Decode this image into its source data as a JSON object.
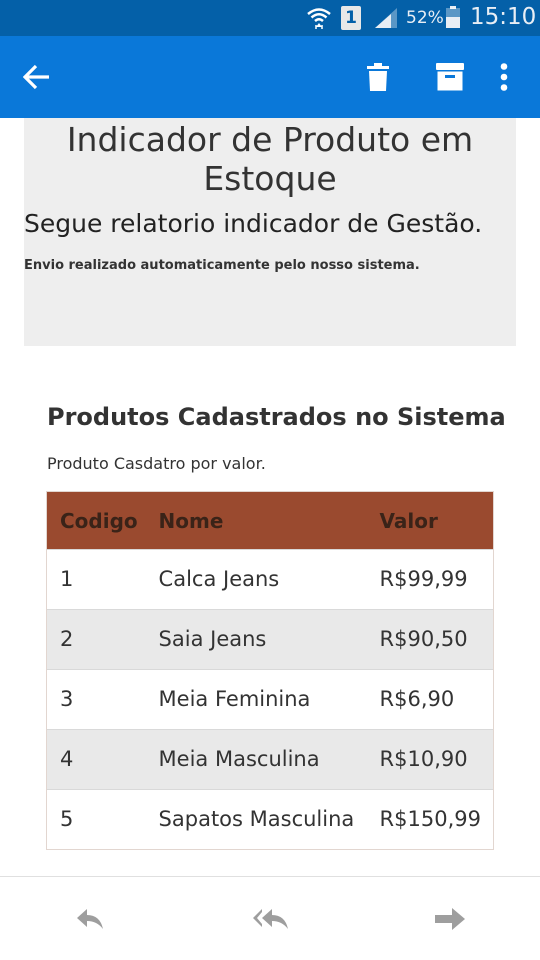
{
  "status_bar": {
    "sim_slot": "1",
    "battery_percent": "52%",
    "time": "15:10",
    "icons": [
      "wifi-icon",
      "sim-icon",
      "signal-icon",
      "battery-icon"
    ]
  },
  "app_bar": {
    "icons": [
      "back-arrow-icon",
      "delete-icon",
      "archive-icon",
      "more-vert-icon"
    ],
    "color": "#0a78d9"
  },
  "email": {
    "header": {
      "title": "Indicador de Produto em Estoque",
      "subtitle": "Segue relatorio indicador de Gestão.",
      "note": "Envio realizado automaticamente pelo nosso sistema."
    },
    "section": {
      "title": "Produtos Cadastrados no Sistema",
      "description": "Produto Casdatro por valor."
    },
    "table": {
      "header_color": "#9a4a2f",
      "columns": [
        "Codigo",
        "Nome",
        "Valor"
      ],
      "rows": [
        [
          "1",
          "Calca Jeans",
          "R$99,99"
        ],
        [
          "2",
          "Saia Jeans",
          "R$90,50"
        ],
        [
          "3",
          "Meia Feminina",
          "R$6,90"
        ],
        [
          "4",
          "Meia Masculina",
          "R$10,90"
        ],
        [
          "5",
          "Sapatos Masculina",
          "R$150,99"
        ]
      ]
    }
  },
  "bottom_bar": {
    "icons": [
      "reply-icon",
      "reply-all-icon",
      "forward-icon"
    ]
  }
}
